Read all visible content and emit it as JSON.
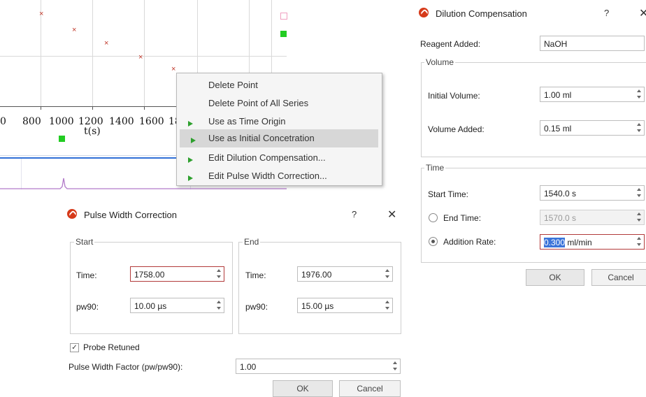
{
  "plot": {
    "x_tick_labels": [
      "0",
      "800",
      "1000",
      "1200",
      "1400",
      "1600",
      "18"
    ],
    "x_axis_label": "t(s)",
    "series_colors": {
      "x_markers": "#c0392b",
      "squares": "#22cc22",
      "baseline": "#2f6fd6",
      "trace": "#b27ac9"
    }
  },
  "context_menu": {
    "items": [
      {
        "label": "Delete Point",
        "icon": "",
        "selected": false
      },
      {
        "label": "Delete Point of All Series",
        "icon": "",
        "selected": false
      },
      {
        "label": "Use as Time Origin",
        "icon": "play-icon",
        "selected": false
      },
      {
        "label": "Use as Initial Concetration",
        "icon": "play-icon",
        "selected": true
      },
      {
        "label": "Edit Dilution Compensation...",
        "icon": "play-icon",
        "selected": false
      },
      {
        "label": "Edit Pulse Width Correction...",
        "icon": "play-icon",
        "selected": false
      }
    ]
  },
  "pulse_dialog": {
    "title": "Pulse Width Correction",
    "help": "?",
    "close": "✕",
    "start_group": "Start",
    "end_group": "End",
    "start": {
      "time_label": "Time:",
      "time_value": "1758.00",
      "pw90_label": "pw90:",
      "pw90_value": "10.00 µs"
    },
    "end": {
      "time_label": "Time:",
      "time_value": "1976.00",
      "pw90_label": "pw90:",
      "pw90_value": "15.00 µs"
    },
    "probe_label": "Probe Retuned",
    "probe_checked": true,
    "factor_label": "Pulse Width Factor (pw/pw90):",
    "factor_value": "1.00",
    "ok": "OK",
    "cancel": "Cancel"
  },
  "dilution_dialog": {
    "title": "Dilution Compensation",
    "help": "?",
    "close": "✕",
    "reagent_label": "Reagent Added:",
    "reagent_value": "NaOH",
    "volume_group": "Volume",
    "initial_volume_label": "Initial Volume:",
    "initial_volume_value": "1.00 ml",
    "volume_added_label": "Volume Added:",
    "volume_added_value": "0.15 ml",
    "time_group": "Time",
    "start_time_label": "Start Time:",
    "start_time_value": "1540.0 s",
    "end_time_label": "End Time:",
    "end_time_value": "1570.0 s",
    "addition_rate_label": "Addition Rate:",
    "addition_rate_selected": "0.300",
    "addition_rate_unit": " ml/min",
    "rate_mode": "addition-rate",
    "ok": "OK",
    "cancel": "Cancel"
  }
}
